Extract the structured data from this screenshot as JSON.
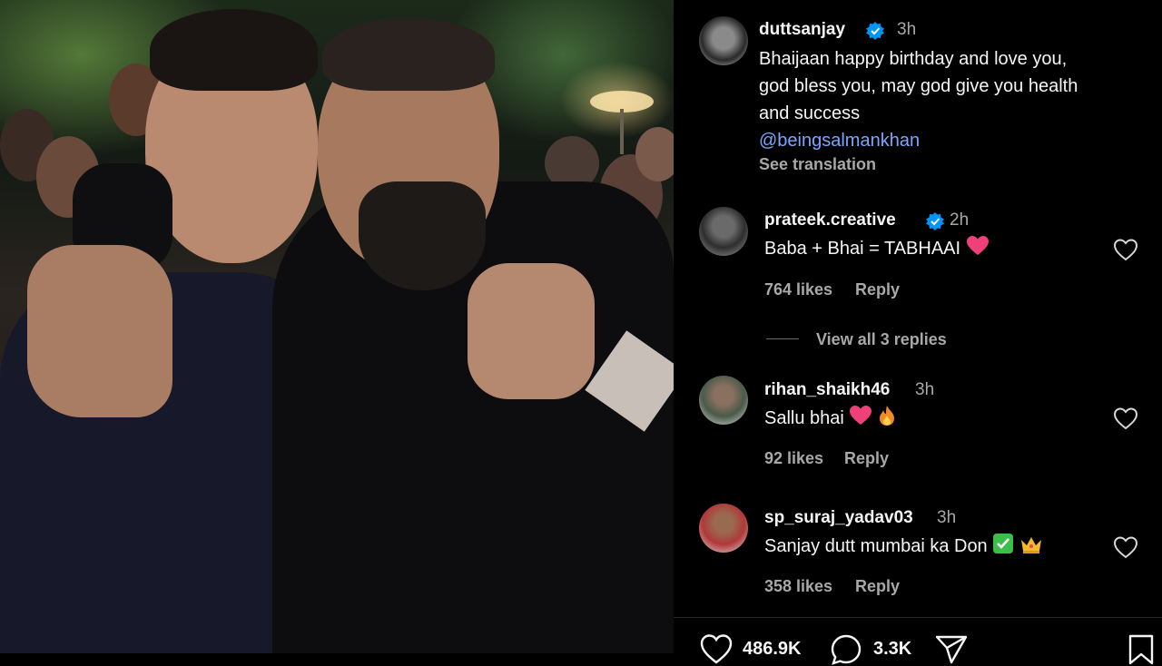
{
  "post": {
    "author": "duttsanjay",
    "time": "3h",
    "caption_line1": "Bhaijaan happy birthday and love you,",
    "caption_line2": "god bless you, may god give you health",
    "caption_line3": "and success",
    "mention": "@beingsalmankhan",
    "see_translation": "See translation"
  },
  "comments": [
    {
      "user": "prateek.creative",
      "verified": true,
      "time": "2h",
      "text": "Baba + Bhai = TABHAAI",
      "emoji": "heart-emoji",
      "likes": "764 likes",
      "reply": "Reply",
      "view_replies": "View all 3 replies"
    },
    {
      "user": "rihan_shaikh46",
      "time": "3h",
      "text": "Sallu bhai",
      "emoji": "heart-fire-emoji",
      "likes": "92 likes",
      "reply": "Reply"
    },
    {
      "user": "sp_suraj_yadav03",
      "time": "3h",
      "text": "Sanjay dutt mumbai ka Don",
      "emoji": "check-crown-emoji",
      "likes": "358 likes",
      "reply": "Reply"
    }
  ],
  "actions": {
    "likes": "486.9K",
    "comments": "3.3K"
  },
  "colors": {
    "verified": "#0095f6",
    "link": "#7aa7ff",
    "heart_emoji": "#f0407a",
    "check_emoji": "#3cbf4a"
  }
}
